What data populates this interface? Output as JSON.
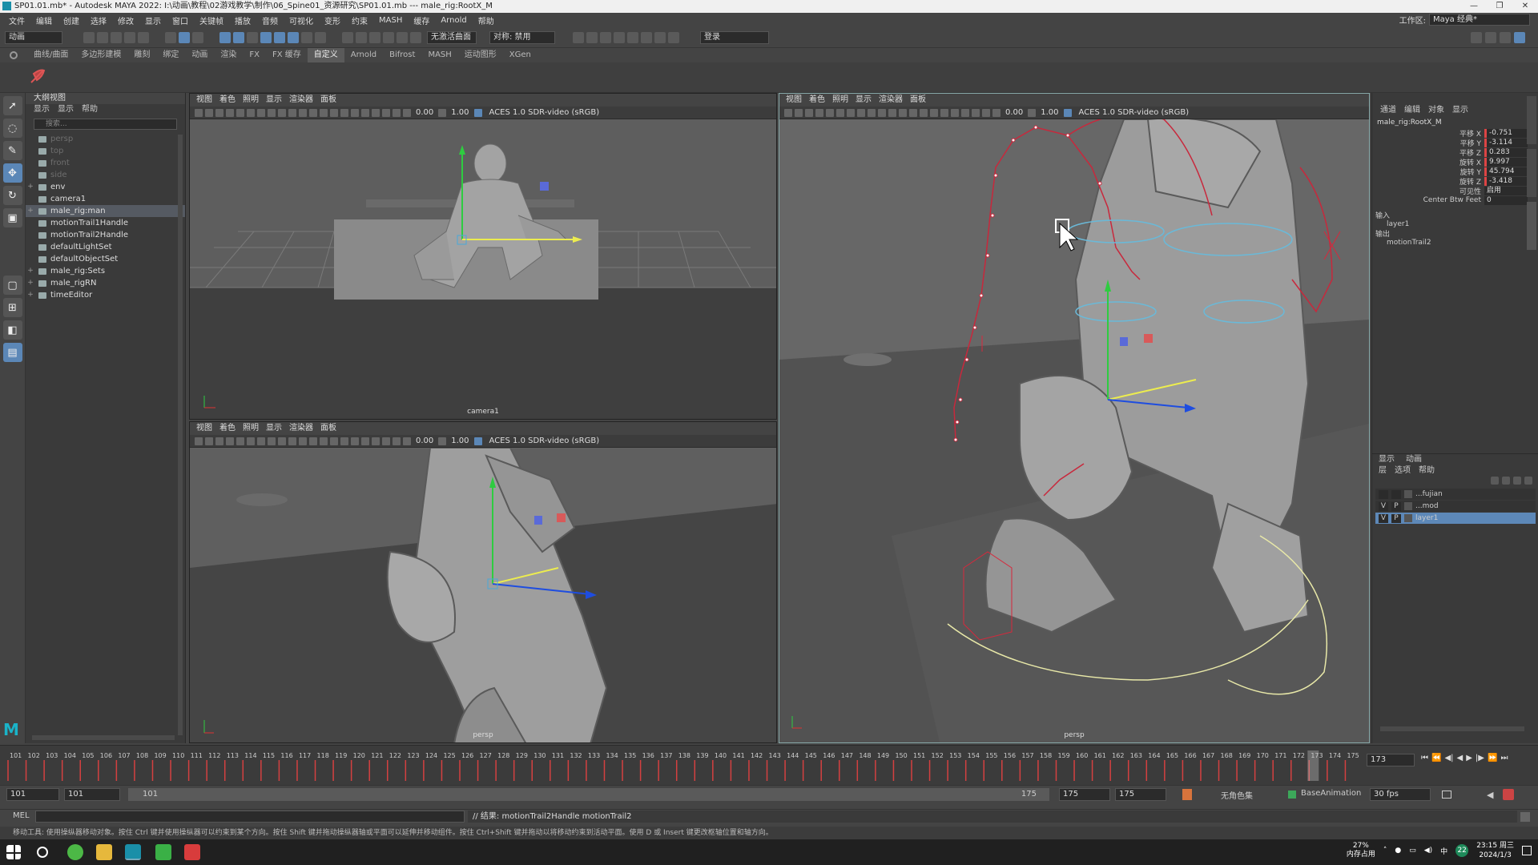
{
  "title": "SP01.01.mb* - Autodesk MAYA 2022: I:\\动画\\教程\\02游戏教学\\制作\\06_Spine01_资源研究\\SP01.01.mb  ---  male_rig:RootX_M",
  "window_controls": [
    "—",
    "❐",
    "✕"
  ],
  "menus": [
    "文件",
    "编辑",
    "创建",
    "选择",
    "修改",
    "显示",
    "窗口",
    "关键帧",
    "播放",
    "音频",
    "可视化",
    "变形",
    "约束",
    "MASH",
    "缓存",
    "Arnold",
    "帮助"
  ],
  "workspace": {
    "label": "工作区:",
    "value": "Maya 经典*"
  },
  "status": {
    "mode": "动画",
    "curve_label": "无激活曲面",
    "symmetry": "对称: 禁用",
    "login": "登录"
  },
  "shelf_tabs": [
    "曲线/曲面",
    "多边形建模",
    "雕刻",
    "绑定",
    "动画",
    "渲染",
    "FX",
    "FX 缓存",
    "自定义",
    "Arnold",
    "Bifrost",
    "MASH",
    "运动图形",
    "XGen"
  ],
  "active_shelf_tab": "自定义",
  "outliner": {
    "title": "大纲视图",
    "menus": [
      "显示",
      "显示",
      "帮助"
    ],
    "search_placeholder": "搜索...",
    "items": [
      {
        "label": "persp",
        "dim": true,
        "exp": "",
        "indent": 0
      },
      {
        "label": "top",
        "dim": true,
        "exp": "",
        "indent": 0
      },
      {
        "label": "front",
        "dim": true,
        "exp": "",
        "indent": 0
      },
      {
        "label": "side",
        "dim": true,
        "exp": "",
        "indent": 0
      },
      {
        "label": "env",
        "dim": false,
        "exp": "+",
        "indent": 0
      },
      {
        "label": "camera1",
        "dim": false,
        "exp": "",
        "indent": 0
      },
      {
        "label": "male_rig:man",
        "dim": false,
        "exp": "+",
        "indent": 0,
        "selected": true
      },
      {
        "label": "motionTrail1Handle",
        "dim": false,
        "exp": "",
        "indent": 0
      },
      {
        "label": "motionTrail2Handle",
        "dim": false,
        "exp": "",
        "indent": 0
      },
      {
        "label": "defaultLightSet",
        "dim": false,
        "exp": "",
        "indent": 0
      },
      {
        "label": "defaultObjectSet",
        "dim": false,
        "exp": "",
        "indent": 0
      },
      {
        "label": "male_rig:Sets",
        "dim": false,
        "exp": "+",
        "indent": 0
      },
      {
        "label": "male_rigRN",
        "dim": false,
        "exp": "+",
        "indent": 0
      },
      {
        "label": "timeEditor",
        "dim": false,
        "exp": "+",
        "indent": 0
      }
    ]
  },
  "viewport_menus": [
    "视图",
    "着色",
    "照明",
    "显示",
    "渲染器",
    "面板"
  ],
  "viewport_toolbar": {
    "v1": "0.00",
    "v2": "1.00",
    "colorspace": "ACES 1.0 SDR-video (sRGB)"
  },
  "viewports": {
    "tl": "camera1",
    "bl": "persp",
    "right": "persp"
  },
  "channel_box": {
    "menus": [
      "通道",
      "编辑",
      "对象",
      "显示"
    ],
    "object": "male_rig:RootX_M",
    "channels": [
      {
        "label": "平移 X",
        "value": "-0.751",
        "key": true
      },
      {
        "label": "平移 Y",
        "value": "-3.114",
        "key": true
      },
      {
        "label": "平移 Z",
        "value": "0.283",
        "key": true
      },
      {
        "label": "旋转 X",
        "value": "9.997",
        "key": true
      },
      {
        "label": "旋转 Y",
        "value": "45.794",
        "key": true
      },
      {
        "label": "旋转 Z",
        "value": "-3.418",
        "key": true
      },
      {
        "label": "可见性",
        "value": "启用",
        "key": false
      },
      {
        "label": "Center Btw Feet",
        "value": "0",
        "key": false
      }
    ],
    "inputs_label": "输入",
    "inputs": [
      "layer1"
    ],
    "outputs_label": "输出",
    "outputs": [
      "motionTrail2"
    ]
  },
  "layer_editor": {
    "tabs": [
      "显示",
      "动画"
    ],
    "menus": [
      "层",
      "选项",
      "帮助"
    ],
    "layers": [
      {
        "v": "",
        "p": "",
        "name": "...fujian",
        "selected": false
      },
      {
        "v": "V",
        "p": "P",
        "name": "...mod",
        "selected": false
      },
      {
        "v": "V",
        "p": "P",
        "name": "layer1",
        "selected": true
      }
    ]
  },
  "timeline": {
    "ticks": [
      "101",
      "102",
      "103",
      "104",
      "105",
      "106",
      "107",
      "108",
      "109",
      "110",
      "111",
      "112",
      "113",
      "114",
      "115",
      "116",
      "117",
      "118",
      "119",
      "120",
      "121",
      "122",
      "123",
      "124",
      "125",
      "126",
      "127",
      "128",
      "129",
      "130",
      "131",
      "132",
      "133",
      "134",
      "135",
      "136",
      "137",
      "138",
      "139",
      "140",
      "141",
      "142",
      "143",
      "144",
      "145",
      "146",
      "147",
      "148",
      "149",
      "150",
      "151",
      "152",
      "153",
      "154",
      "155",
      "156",
      "157",
      "158",
      "159",
      "160",
      "161",
      "162",
      "163",
      "164",
      "165",
      "166",
      "167",
      "168",
      "169",
      "170",
      "171",
      "172",
      "173",
      "174",
      "175"
    ],
    "current_frame": "173",
    "current_field": "173",
    "play_buttons": [
      "⏮",
      "⏪",
      "◀|",
      "◀",
      "▶",
      "|▶",
      "⏩",
      "⏭"
    ]
  },
  "range": {
    "start": "101",
    "start2": "101",
    "slider_start": "101",
    "slider_end": "175",
    "end": "175",
    "end2": "175",
    "charset": "无角色集",
    "layer": "BaseAnimation",
    "fps": "30 fps"
  },
  "command": {
    "lang": "MEL",
    "result": "// 结果: motionTrail2Handle motionTrail2"
  },
  "help_text": "移动工具: 使用操纵器移动对象。按住 Ctrl 键并使用操纵器可以约束到某个方向。按住 Shift 键并拖动操纵器轴或平面可以延伸并移动组件。按住 Ctrl+Shift 键并拖动以将移动约束到活动平面。使用 D 或 Insert 键更改枢轴位置和轴方向。",
  "taskbar": {
    "mem_pct": "27%",
    "mem_label": "内存占用",
    "ime": "中",
    "time": "23:15 周三",
    "date": "2024/1/3",
    "badge": "22"
  },
  "colors": {
    "accent": "#5b87b7",
    "key": "#d44040",
    "trail": "#c8283c",
    "selection": "#5d88b8"
  }
}
